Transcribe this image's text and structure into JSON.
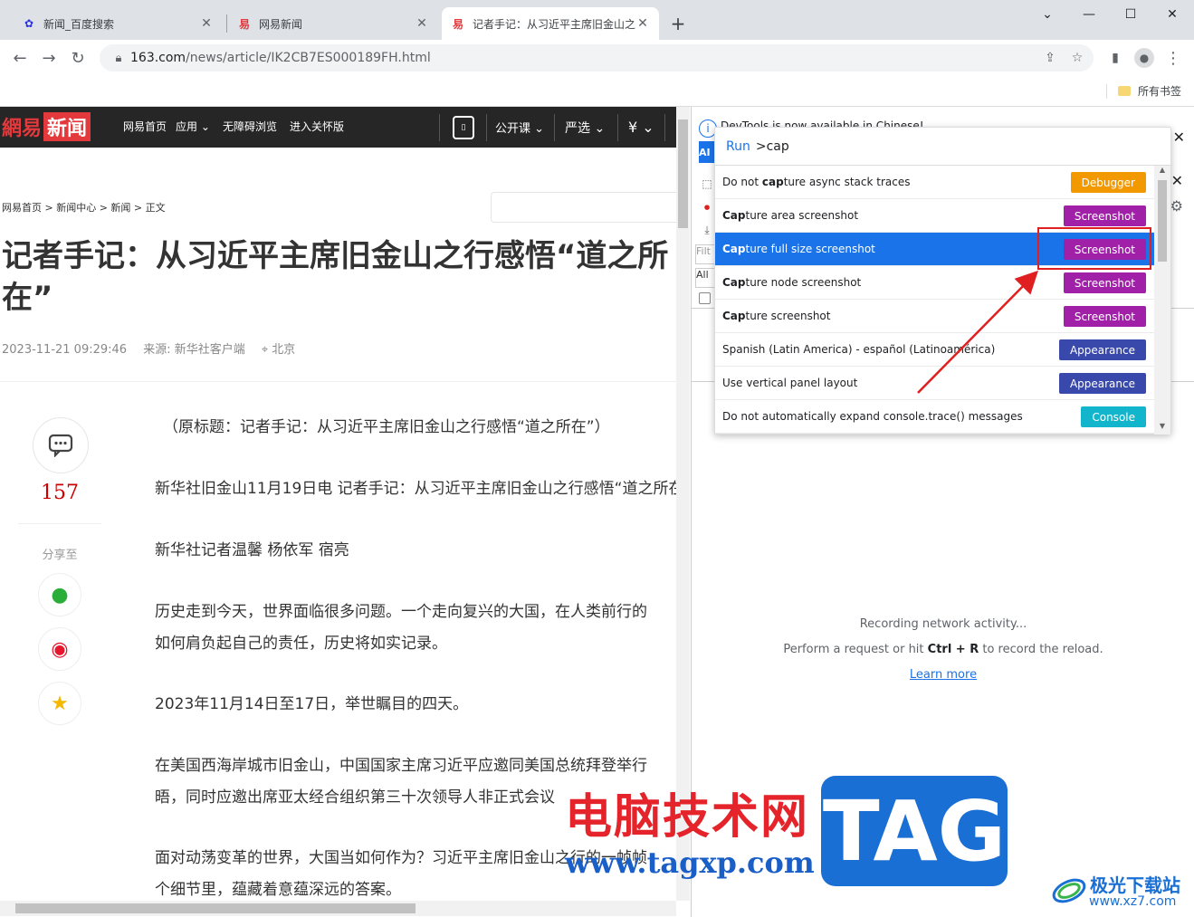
{
  "tabs": [
    {
      "title": "新闻_百度搜索",
      "favicon": "baidu-paw-icon"
    },
    {
      "title": "网易新闻",
      "favicon": "netease-icon"
    },
    {
      "title": "记者手记：从习近平主席旧金山之行感悟“道之所在”",
      "favicon": "netease-icon"
    }
  ],
  "new_tab": "+",
  "address": {
    "host": "163.com",
    "path": "/news/article/IK2CB7ES000189FH.html"
  },
  "bookmarks": {
    "all_label": "所有书签"
  },
  "site_nav": {
    "logo_a": "網易",
    "logo_b": "新闻",
    "links": [
      "网易首页",
      "应用",
      "无障碍浏览",
      "进入关怀版"
    ],
    "right_links": [
      "公开课",
      "严选",
      "¥"
    ]
  },
  "article": {
    "breadcrumb": "网易首页 > 新闻中心 > 新闻 > 正文",
    "headline": "记者手记：从习近平主席旧金山之行感悟“道之所在”",
    "date": "2023-11-21 09:29:46",
    "source": "来源: 新华社客户端",
    "location": "北京",
    "comment_count": "157",
    "share_label": "分享至",
    "paragraphs": [
      "（原标题：记者手记：从习近平主席旧金山之行感悟“道之所在”）",
      "新华社旧金山11月19日电 记者手记：从习近平主席旧金山之行感悟“道之所在”",
      "新华社记者温馨 杨依军 宿亮",
      "历史走到今天，世界面临很多问题。一个走向复兴的大国，在人类前行的",
      "如何肩负起自己的责任，历史将如实记录。",
      "2023年11月14日至17日，举世瞩目的四天。",
      "在美国西海岸城市旧金山，中国国家主席习近平应邀同美国总统拜登举行",
      "晤，同时应邀出席亚太经合组织第三十次领导人非正式会议",
      "面对动荡变革的世界，大国当如何作为？习近平主席旧金山之行的一帧帧",
      "个细节里，蕴藏着意蕴深远的答案。"
    ]
  },
  "devtools": {
    "info_text": "DevTools is now available in Chinese!",
    "blue_label": "AI",
    "filter_label": "Filt",
    "all_label": "All",
    "recording": "Recording network activity...",
    "hint_prefix": "Perform a request or hit ",
    "hint_keys": "Ctrl + R",
    "hint_suffix": " to record the reload.",
    "learn_more": "Learn more"
  },
  "command_menu": {
    "prompt": "Run",
    "query": ">cap",
    "items": [
      {
        "label": "Do not capture async stack traces",
        "badge": "Debugger",
        "badge_color": "#f29900"
      },
      {
        "label": "Capture area screenshot",
        "badge": "Screenshot",
        "badge_color": "#a020a8"
      },
      {
        "label": "Capture full size screenshot",
        "badge": "Screenshot",
        "badge_color": "#a020a8",
        "selected": true
      },
      {
        "label": "Capture node screenshot",
        "badge": "Screenshot",
        "badge_color": "#a020a8"
      },
      {
        "label": "Capture screenshot",
        "badge": "Screenshot",
        "badge_color": "#a020a8"
      },
      {
        "label": "Spanish (Latin America) - español (Latinoamérica)",
        "badge": "Appearance",
        "badge_color": "#3949ab"
      },
      {
        "label": "Use vertical panel layout",
        "badge": "Appearance",
        "badge_color": "#3949ab"
      },
      {
        "label": "Do not automatically expand console.trace() messages",
        "badge": "Console",
        "badge_color": "#12b5cb"
      }
    ]
  },
  "watermark": {
    "title": "电脑技术网",
    "url": "www.tagxp.com",
    "tag": "TAG",
    "brand": "极光下载站",
    "brand_url": "www.xz7.com"
  },
  "colors": {
    "accent": "#1a73e8",
    "highlight_box": "#e02020",
    "netease_red": "#e4393c"
  }
}
